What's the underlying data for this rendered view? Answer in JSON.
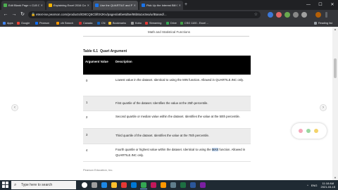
{
  "browser": {
    "tabs": [
      {
        "label": "Edit Blank Page < CLB CSG 1TC",
        "fav_color": "#4caf50"
      },
      {
        "label": "Explaining Excel 2016 Composite",
        "fav_color": "#f4b400"
      },
      {
        "label": "Use the QUARTILE and PERCENTIL",
        "fav_color": "#1a73e8",
        "active": true
      },
      {
        "label": "Pick Up the Interest Bill Comple",
        "fav_color": "#1a73e8"
      }
    ],
    "new_tab": "+",
    "window_controls": {
      "minimize": "—",
      "maximize": "☐",
      "close": "✕"
    },
    "nav": {
      "back": "←",
      "forward": "→",
      "reload": "↻"
    },
    "lock": "🔒",
    "url": "etext-ise.pearson.com/products/ID8CQ5Cbf0X2Kv/pages/a8be6d5e/86b8a1e3ea/urlBased/...",
    "star": "☆",
    "bookmarks": [
      {
        "label": "Apps",
        "color": "#4285f4"
      },
      {
        "label": "Google",
        "color": "#ea4335"
      },
      {
        "label": "Pearson",
        "color": "#0d6efd"
      },
      {
        "label": "clb Search",
        "color": "#ff9800"
      },
      {
        "label": "Canada",
        "color": "#d32f2f"
      },
      {
        "label": "CN",
        "color": "#1565c0"
      },
      {
        "label": "Bookmarks",
        "color": "#fbc02d"
      },
      {
        "label": "Kobo",
        "color": "#9e9e9e"
      },
      {
        "label": "Streaming",
        "color": "#e53935"
      },
      {
        "label": "Drive",
        "color": "#34a853"
      },
      {
        "label": "CSG 1100 - Excel ...",
        "color": "#43a047"
      }
    ],
    "reading_list": "Reading list"
  },
  "page": {
    "running_head": "Math and Statistical Functions",
    "table_caption_label": "Table 6.1",
    "table_caption_title": "Quart Argument",
    "columns": [
      "Argument Value",
      "Description"
    ],
    "rows": [
      {
        "value": "0",
        "desc_before": "Lowest value in the dataset. Identical to using the MIN function. Allowed in QUARTILE.INC only.",
        "desc_hl": "",
        "desc_after": ""
      },
      {
        "value": "1",
        "desc_before": "First quartile of the dataset. Identifies the value at the 25th percentile.",
        "desc_hl": "",
        "desc_after": ""
      },
      {
        "value": "2",
        "desc_before": "Second quartile or median value within the dataset. Identifies the value at the 50th percentile.",
        "desc_hl": "",
        "desc_after": ""
      },
      {
        "value": "3",
        "desc_before": "Third quartile of the dataset. Identifies the value at the 75th percentile.",
        "desc_hl": "",
        "desc_after": ""
      },
      {
        "value": "4",
        "desc_before": "Fourth quartile or highest value within the dataset. Identical to using the ",
        "desc_hl": "MAX",
        "desc_after": " function. Allowed in QUARTILE.INC only."
      }
    ],
    "footnote": "Pearson Education, Inc."
  },
  "nav_arrows": {
    "prev": "‹",
    "next": "›"
  },
  "scrollbar": {
    "up": "▲",
    "down": "▼"
  },
  "taskbar": {
    "search_placeholder": "Type here to search",
    "search_icon": "⌕",
    "tray": {
      "weather": "^",
      "lang": "ENG",
      "time": "11:18 AM",
      "date": "2021-03-15"
    }
  }
}
